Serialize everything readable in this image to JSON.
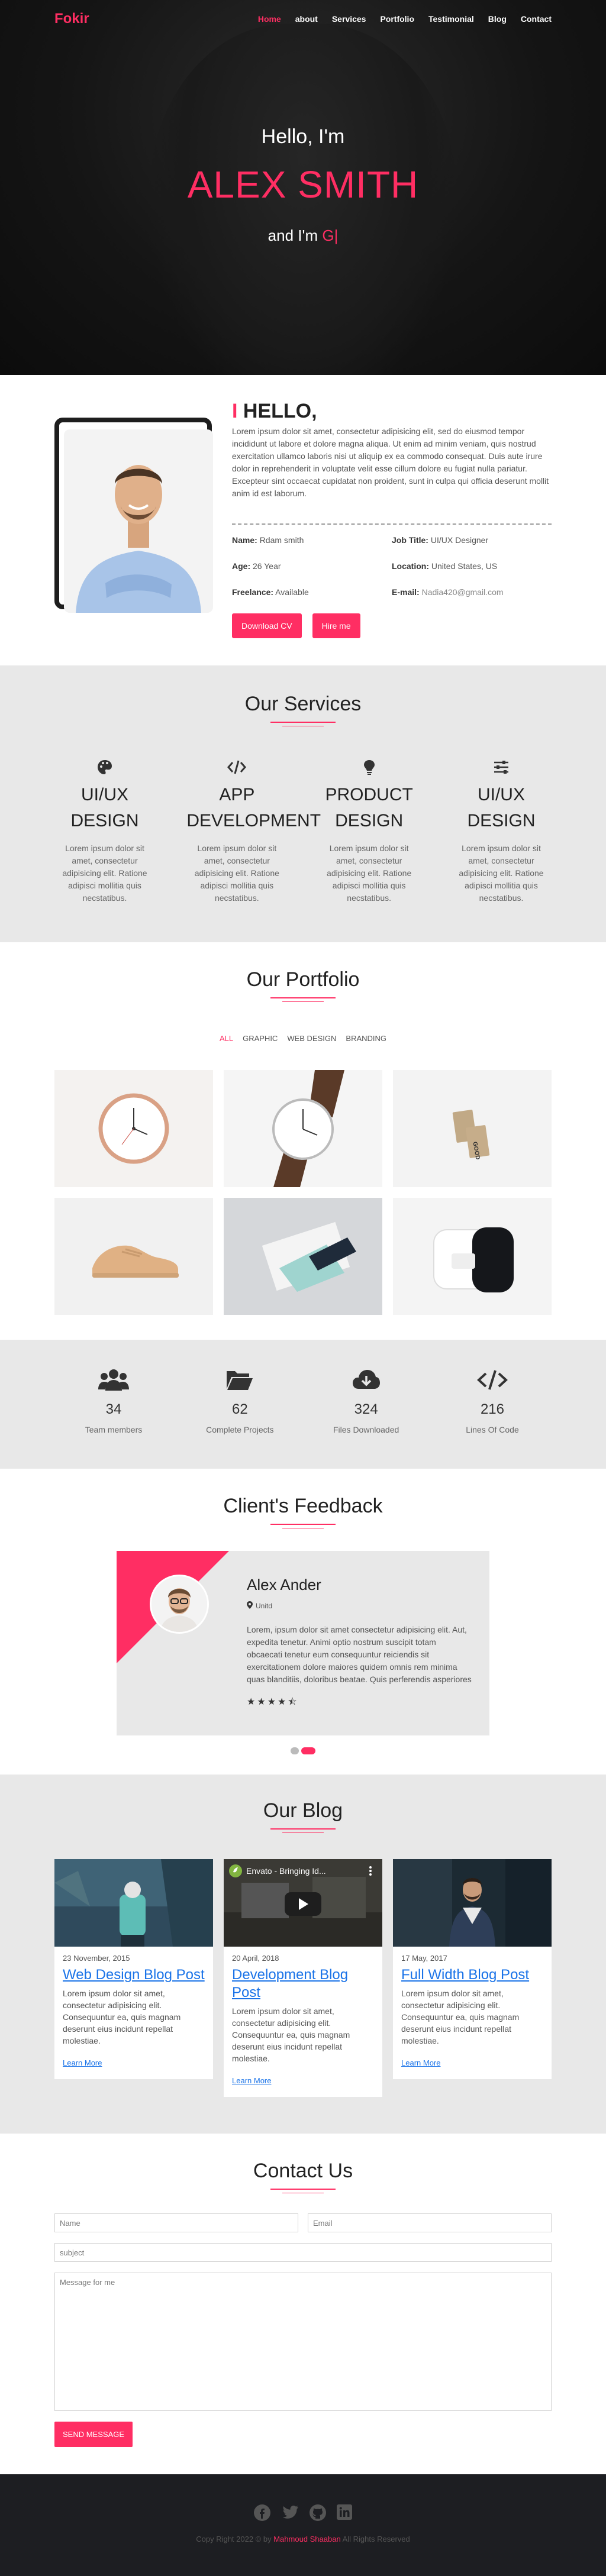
{
  "nav": {
    "logo": "Fokir",
    "items": [
      "Home",
      "about",
      "Services",
      "Portfolio",
      "Testimonial",
      "Blog",
      "Contact"
    ]
  },
  "hero": {
    "greeting": "Hello, I'm",
    "name": "ALEX SMITH",
    "typed_prefix": "and I'm ",
    "typed_text": "G|"
  },
  "about": {
    "title_mark": "I",
    "title": " HELLO,",
    "description": "Lorem ipsum dolor sit amet, consectetur adipisicing elit, sed do eiusmod tempor incididunt ut labore et dolore magna aliqua. Ut enim ad minim veniam, quis nostrud exercitation ullamco laboris nisi ut aliquip ex ea commodo consequat. Duis aute irure dolor in reprehenderit in voluptate velit esse cillum dolore eu fugiat nulla pariatur. Excepteur sint occaecat cupidatat non proident, sunt in culpa qui officia deserunt mollit anim id est laborum.",
    "details": [
      {
        "label": "Name:",
        "value": "Rdam smith"
      },
      {
        "label": "Job Title:",
        "value": "UI/UX Designer"
      },
      {
        "label": "Age:",
        "value": "26 Year"
      },
      {
        "label": "Location:",
        "value": "United States, US"
      },
      {
        "label": "Freelance:",
        "value": "Available"
      },
      {
        "label": "E-mail:",
        "value": "Nadia420@gmail.com"
      }
    ],
    "download_label": "Download CV",
    "hire_label": "Hire me"
  },
  "services": {
    "title": "Our Services",
    "items": [
      {
        "icon": "palette-icon",
        "title": "UI/UX DESIGN",
        "desc": "Lorem ipsum dolor sit amet, consectetur adipisicing elit. Ratione adipisci mollitia quis necstatibus."
      },
      {
        "icon": "code-icon",
        "title": "APP DEVELOPMENT",
        "desc": "Lorem ipsum dolor sit amet, consectetur adipisicing elit. Ratione adipisci mollitia quis necstatibus."
      },
      {
        "icon": "lightbulb-icon",
        "title": "PRODUCT DESIGN",
        "desc": "Lorem ipsum dolor sit amet, consectetur adipisicing elit. Ratione adipisci mollitia quis necstatibus."
      },
      {
        "icon": "sliders-icon",
        "title": "UI/UX DESIGN",
        "desc": "Lorem ipsum dolor sit amet, consectetur adipisicing elit. Ratione adipisci mollitia quis necstatibus."
      }
    ]
  },
  "portfolio": {
    "title": "Our Portfolio",
    "filters": [
      "ALL",
      "GRAPHIC",
      "WEB DESIGN",
      "BRANDING"
    ],
    "items": [
      "rose-gold-wall-clock",
      "leather-strap-watch",
      "kraft-business-cards",
      "tan-sneaker",
      "business-card-stack",
      "white-speaker"
    ]
  },
  "stats": [
    {
      "icon": "users-icon",
      "num": "34",
      "label": "Team members"
    },
    {
      "icon": "folder-open-icon",
      "num": "62",
      "label": "Complete Projects"
    },
    {
      "icon": "cloud-download-icon",
      "num": "324",
      "label": "Files Downloaded"
    },
    {
      "icon": "code-icon",
      "num": "216",
      "label": "Lines Of Code"
    }
  ],
  "feedback": {
    "title": "Client's Feedback",
    "name": "Alex Ander",
    "location": "Unitd",
    "text": "Lorem, ipsum dolor sit amet consectetur adipisicing elit. Aut, expedita tenetur. Animi optio nostrum suscipit totam obcaecati tenetur eum consequuntur reiciendis sit exercitationem dolore maiores quidem omnis rem minima quas blanditiis, doloribus beatae. Quis perferendis asperiores",
    "stars": "★★★★⯪",
    "rating": 4.5
  },
  "blog": {
    "title": "Our Blog",
    "video_title": "Envato - Bringing Id...",
    "posts": [
      {
        "date": "23 November, 2015",
        "title": "Web Design Blog Post",
        "desc": "Lorem ipsum dolor sit amet, consectetur adipisicing elit. Consequuntur ea, quis magnam deserunt eius incidunt repellat molestiae.",
        "link": "Learn More"
      },
      {
        "date": "20 April, 2018",
        "title": "Development Blog Post",
        "desc": "Lorem ipsum dolor sit amet, consectetur adipisicing elit. Consequuntur ea, quis magnam deserunt eius incidunt repellat molestiae.",
        "link": "Learn More"
      },
      {
        "date": "17 May, 2017",
        "title": "Full Width Blog Post",
        "desc": "Lorem ipsum dolor sit amet, consectetur adipisicing elit. Consequuntur ea, quis magnam deserunt eius incidunt repellat molestiae.",
        "link": "Learn More"
      }
    ]
  },
  "contact": {
    "title": "Contact Us",
    "name_placeholder": "Name",
    "email_placeholder": "Email",
    "subject_placeholder": "subject",
    "message_placeholder": "Message for me",
    "send_label": "SEND MESSAGE"
  },
  "footer": {
    "socials": [
      "facebook-icon",
      "twitter-icon",
      "github-icon",
      "linkedin-icon"
    ],
    "copy_prefix": "Copy Right 2022 © by ",
    "author": "Mahmoud Shaaban",
    "copy_suffix": " All Rights Reserved"
  },
  "colors": {
    "accent": "#ff2e63",
    "dark": "#1d1e22",
    "section_gray": "#e8e8e8"
  }
}
